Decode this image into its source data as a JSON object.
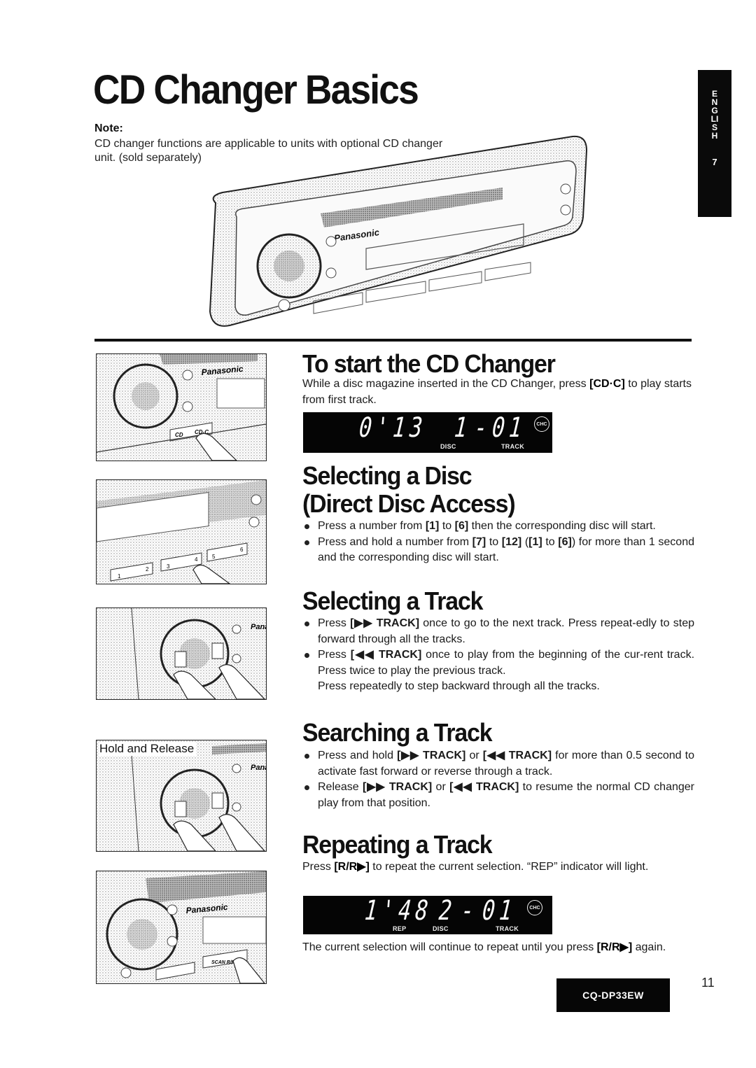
{
  "header": {
    "title": "CD Changer Basics",
    "note_label": "Note:",
    "note_text": "CD changer functions are applicable to units with optional CD changer unit. (sold separately)"
  },
  "language_tab": {
    "letters": "ENGLISH",
    "section_number": "7"
  },
  "illustrations": {
    "hero_brand": "Panasonic",
    "step1_brand": "Panasonic",
    "step1_buttons": [
      "CD",
      "CD-C"
    ],
    "step2_buttons": [
      "1",
      "2",
      "3",
      "4",
      "5",
      "6"
    ],
    "step3_brand": "Pana",
    "step4_label": "Hold and Release",
    "step4_brand": "Pana",
    "step5_brand": "Panasonic",
    "step5_button": "SCAN R/R ▸"
  },
  "sections": {
    "start": {
      "heading": "To start the CD Changer",
      "text_before": "While a disc magazine inserted in the CD Changer, press ",
      "key": "[CD·C]",
      "text_after": " to play starts from first track.",
      "display": {
        "time": "0'13",
        "disc": "1",
        "dash": "-",
        "track": "01",
        "indicator_disc": "DISC",
        "indicator_track": "TRACK",
        "badge": "CHC"
      }
    },
    "select_disc": {
      "heading_line1": "Selecting a Disc",
      "heading_line2": "(Direct Disc Access)",
      "bullets": [
        {
          "a": "Press a number from ",
          "k1": "[1]",
          "b": " to ",
          "k2": "[6]",
          "c": " then the corresponding disc will start."
        },
        {
          "a": "Press and hold a number from ",
          "k1": "[7]",
          "b": " to ",
          "k2": "[12]",
          "c": " (",
          "k3": "[1]",
          "d": " to ",
          "k4": "[6]",
          "e": ") for more than 1 second and the corresponding disc will start."
        }
      ]
    },
    "select_track": {
      "heading": "Selecting a Track",
      "bullets": [
        {
          "a": "Press ",
          "k1": "[▶▶ TRACK]",
          "b": " once to go to the next track. Press repeat-edly to step forward through all the tracks."
        },
        {
          "a": "Press ",
          "k1": "[◀◀ TRACK]",
          "b": " once to play from the beginning of the cur-rent track. Press twice to play the previous track."
        }
      ],
      "continuation": "Press repeatedly to step backward through all the tracks."
    },
    "search_track": {
      "heading": "Searching a Track",
      "bullets": [
        {
          "a": "Press and hold ",
          "k1": "[▶▶ TRACK]",
          "b": " or ",
          "k2": "[◀◀ TRACK]",
          "c": " for more than 0.5 second to activate fast forward or reverse through a track."
        },
        {
          "a": "Release ",
          "k1": "[▶▶ TRACK]",
          "b": " or ",
          "k2": "[◀◀ TRACK]",
          "c": " to resume the normal CD changer play from that position."
        }
      ]
    },
    "repeat_track": {
      "heading": "Repeating a Track",
      "p1_a": "Press ",
      "p1_key": "[R/R▶]",
      "p1_b": " to repeat the current selection. “REP” indicator will light.",
      "display": {
        "time": "1'48",
        "disc": "2",
        "dash": "-",
        "track": "01",
        "indicator_rep": "REP",
        "indicator_disc": "DISC",
        "indicator_track": "TRACK",
        "badge": "CHC"
      },
      "p2_a": "The current selection will continue to repeat until you press ",
      "p2_key": "[R/R▶]",
      "p2_b": " again."
    }
  },
  "footer": {
    "model": "CQ-DP33EW",
    "page_number": "11"
  }
}
